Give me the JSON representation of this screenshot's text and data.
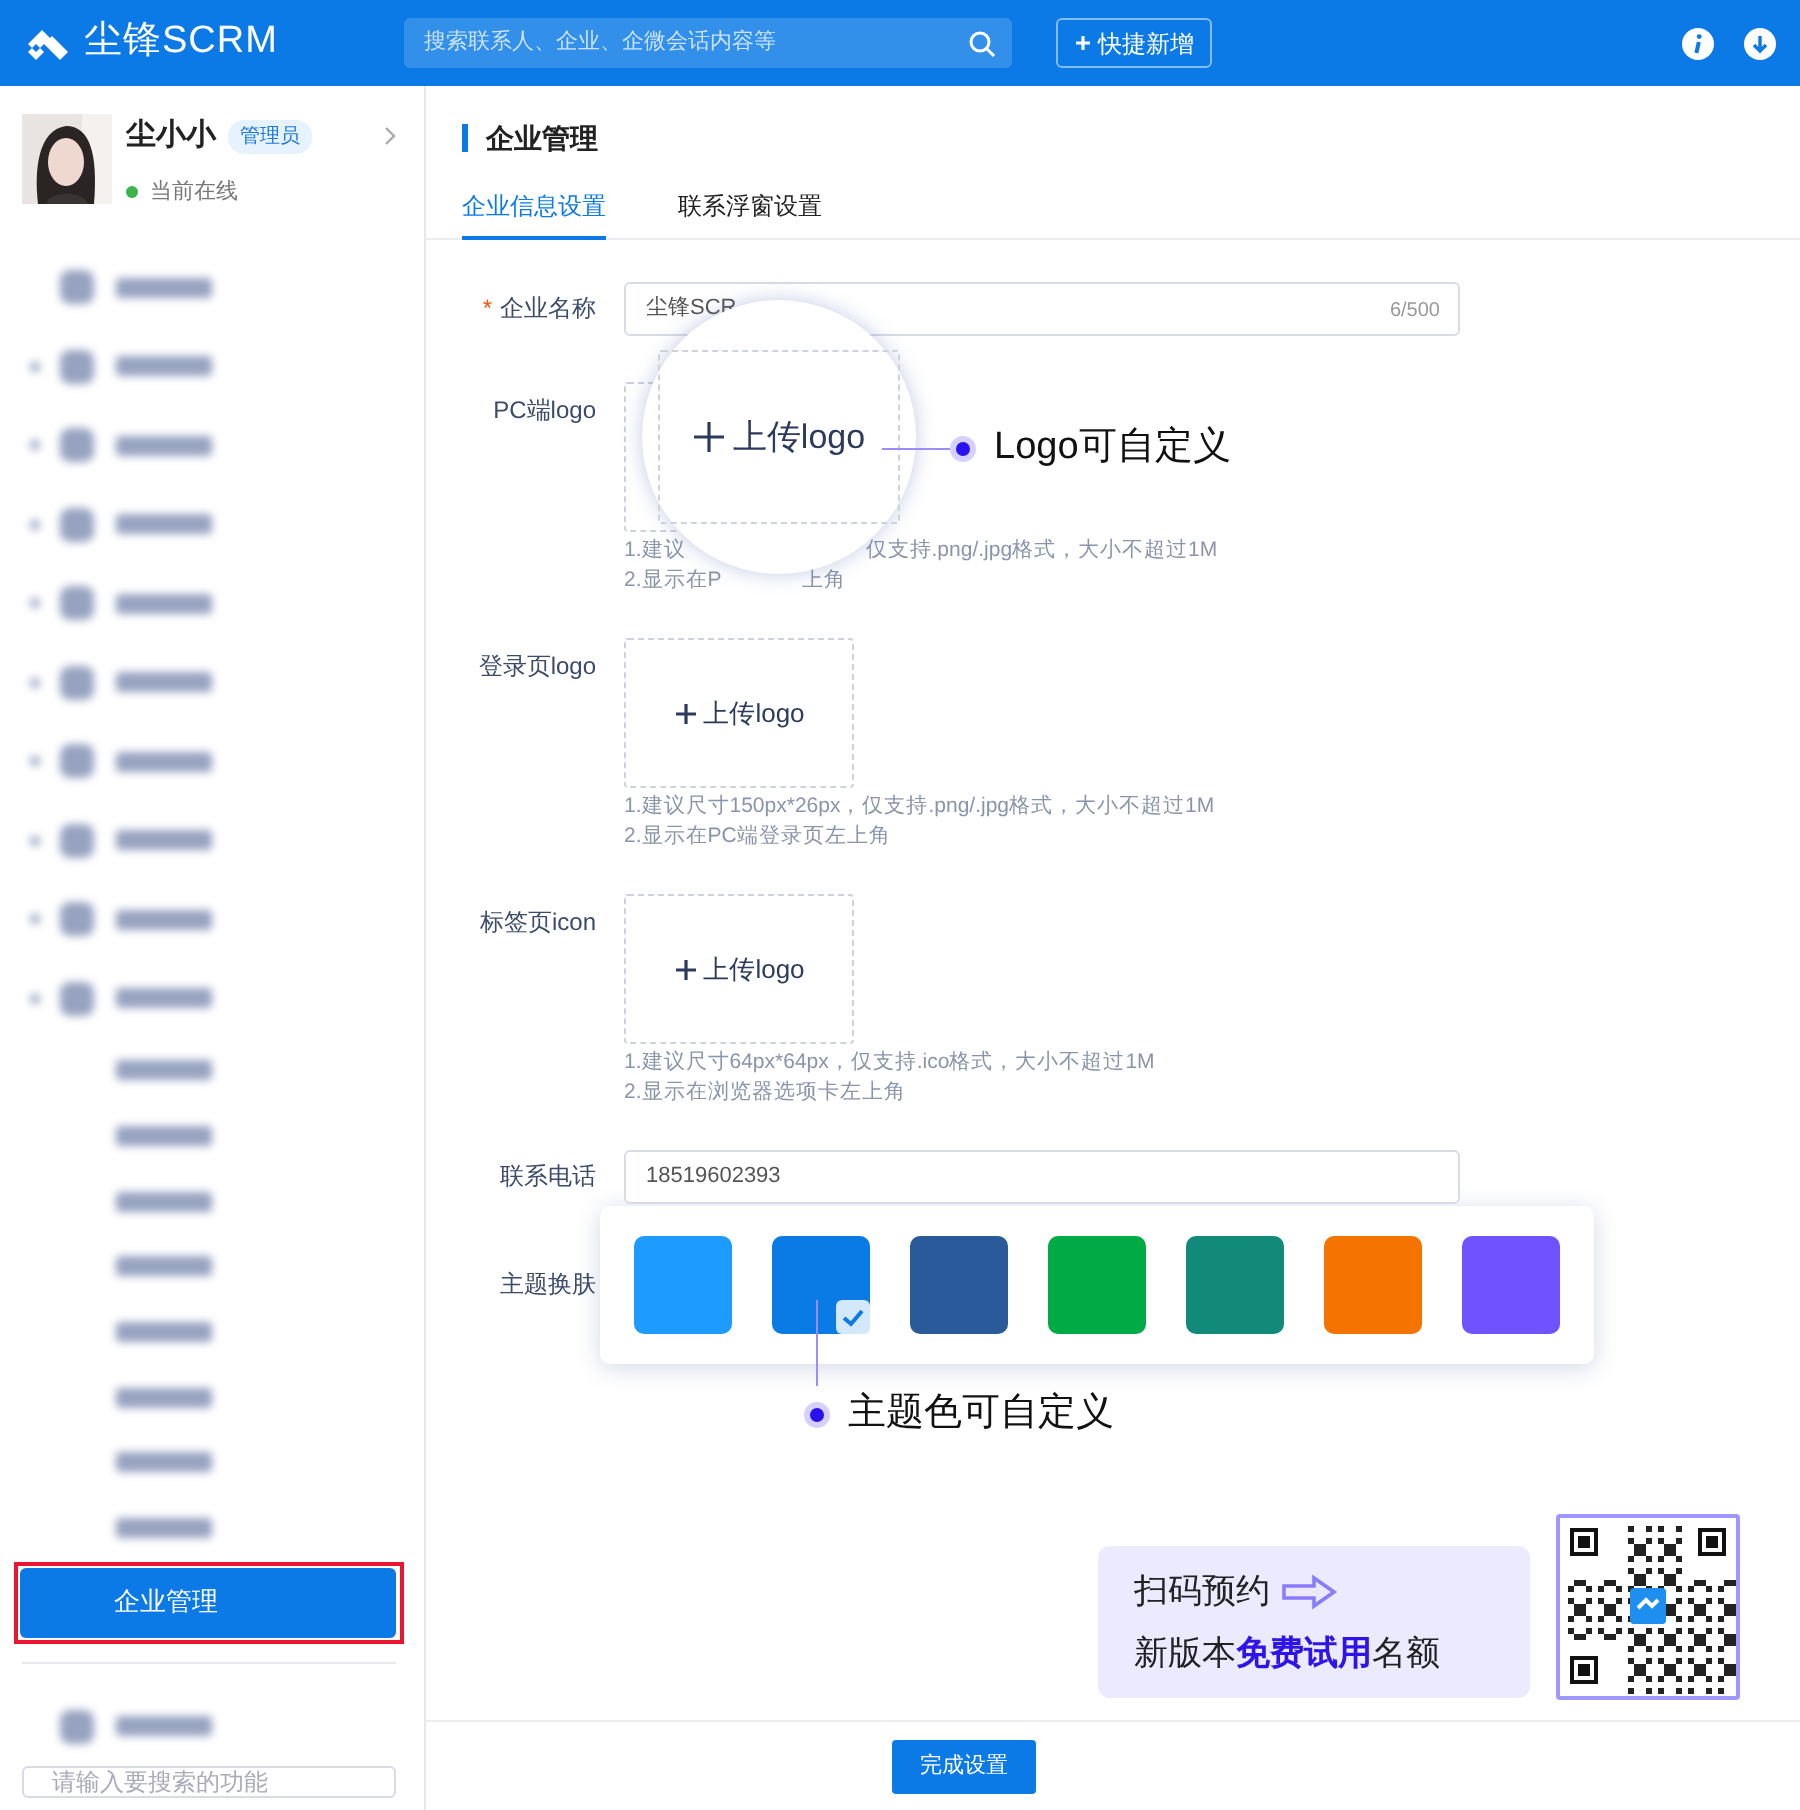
{
  "header": {
    "logo_text": "尘锋SCRM",
    "search": {
      "placeholder": "搜索联系人、企业、企微会话内容等"
    },
    "quick_add": "快捷新增"
  },
  "user": {
    "name": "尘小小",
    "role": "管理员",
    "status": "当前在线",
    "online": true
  },
  "sidebar": {
    "items": [
      {
        "kind": "top",
        "selected": false,
        "annotated": false
      },
      {
        "kind": "group",
        "selected": false,
        "annotated": false
      },
      {
        "kind": "group",
        "selected": false,
        "annotated": false
      },
      {
        "kind": "group",
        "selected": false,
        "annotated": false
      },
      {
        "kind": "group",
        "selected": false,
        "annotated": false
      },
      {
        "kind": "group",
        "selected": false,
        "annotated": false
      },
      {
        "kind": "group",
        "selected": false,
        "annotated": false
      },
      {
        "kind": "group",
        "selected": false,
        "annotated": false
      },
      {
        "kind": "group",
        "selected": false,
        "annotated": false
      },
      {
        "kind": "group",
        "selected": false,
        "annotated": false
      },
      {
        "kind": "sub",
        "selected": false,
        "annotated": false
      },
      {
        "kind": "sub",
        "selected": false,
        "annotated": false
      },
      {
        "kind": "sub",
        "selected": false,
        "annotated": false
      },
      {
        "kind": "sub",
        "selected": false,
        "annotated": false
      },
      {
        "kind": "sub",
        "selected": false,
        "annotated": false
      },
      {
        "kind": "sub",
        "selected": false,
        "annotated": false
      },
      {
        "kind": "sub",
        "selected": false,
        "annotated": false
      },
      {
        "kind": "sub",
        "selected": false,
        "annotated": false
      },
      {
        "kind": "sub",
        "label": "企业管理",
        "selected": true,
        "annotated": true
      },
      {
        "kind": "divider"
      },
      {
        "kind": "top",
        "selected": false,
        "annotated": false
      }
    ],
    "search": {
      "placeholder": "请输入要搜索的功能"
    }
  },
  "page": {
    "title": "企业管理",
    "tabs": [
      {
        "label": "企业信息设置",
        "selected": true
      },
      {
        "label": "联系浮窗设置",
        "selected": false
      }
    ]
  },
  "form": {
    "rows": [
      {
        "kind": "text",
        "label": "企业名称",
        "required_mark": "*",
        "value": "尘锋SCR",
        "counter": "6/500"
      },
      {
        "kind": "upload",
        "label": "PC端logo",
        "hints": [
          {
            "parts": [
              "1.建议",
              "仅支持.png/.jpg格式，大小不超过1M"
            ]
          },
          {
            "parts": [
              "2.显示在P",
              "上角"
            ]
          }
        ]
      },
      {
        "kind": "upload",
        "label": "登录页logo",
        "button": "上传logo",
        "hints": [
          {
            "parts": [
              "1.建议尺寸150px*26px，仅支持.png/.jpg格式，大小不超过1M"
            ]
          },
          {
            "parts": [
              "2.显示在PC端登录页左上角"
            ]
          }
        ]
      },
      {
        "kind": "upload",
        "label": "标签页icon",
        "button": "上传logo",
        "hints": [
          {
            "parts": [
              "1.建议尺寸64px*64px，仅支持.ico格式，大小不超过1M"
            ]
          },
          {
            "parts": [
              "2.显示在浏览器选项卡左上角"
            ]
          }
        ]
      },
      {
        "kind": "text",
        "label": "联系电话",
        "value": "18519602393"
      },
      {
        "kind": "theme",
        "label": "主题换肤",
        "swatches": [
          {
            "color": "#1e9bff",
            "selected": false
          },
          {
            "color": "#0a7be4",
            "selected": true
          },
          {
            "color": "#2b5a9b",
            "selected": false
          },
          {
            "color": "#00aa45",
            "selected": false
          },
          {
            "color": "#128a7a",
            "selected": false
          },
          {
            "color": "#f57300",
            "selected": false
          },
          {
            "color": "#7052ff",
            "selected": false
          }
        ]
      }
    ]
  },
  "callouts": [
    {
      "kind": "magnifier",
      "button": "上传logo",
      "text": "Logo可自定义"
    },
    {
      "kind": "pointer",
      "text": "主题色可自定义"
    }
  ],
  "promo": {
    "line1": "扫码预约",
    "line2": "新版本**免费试用**名额"
  },
  "footer": {
    "button": "完成设置"
  }
}
